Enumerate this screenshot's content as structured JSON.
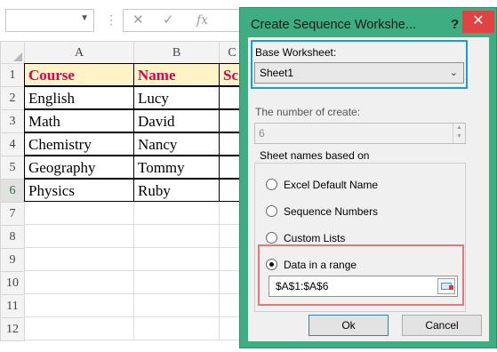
{
  "excel": {
    "fx_label": "fx",
    "columns": [
      "A",
      "B",
      "C"
    ],
    "rows": [
      "1",
      "2",
      "3",
      "4",
      "5",
      "6",
      "7",
      "8",
      "9",
      "10",
      "11",
      "12"
    ],
    "header_row": [
      "Course",
      "Name",
      "Sc"
    ],
    "data": [
      [
        "English",
        "Lucy"
      ],
      [
        "Math",
        "David"
      ],
      [
        "Chemistry",
        "Nancy"
      ],
      [
        "Geography",
        "Tommy"
      ],
      [
        "Physics",
        "Ruby"
      ]
    ]
  },
  "dialog": {
    "title": "Create Sequence Workshe...",
    "help": "?",
    "close": "✕",
    "base_label": "Base Worksheet:",
    "base_value": "Sheet1",
    "num_label": "The number of create:",
    "num_value": "6",
    "group_label": "Sheet names based on",
    "options": [
      "Excel Default Name",
      "Sequence Numbers",
      "Custom Lists",
      "Data in a range"
    ],
    "selected_option": "Data in a range",
    "range_value": "$A$1:$A$6",
    "ok_label": "Ok",
    "cancel_label": "Cancel"
  },
  "colors": {
    "dialog_frame": "#3fad82",
    "close_button": "#e04343",
    "header_fill": "#fff3c7",
    "header_text": "#e1004f",
    "highlight_blue": "#1a9ad6",
    "highlight_red": "#e07a7a"
  }
}
